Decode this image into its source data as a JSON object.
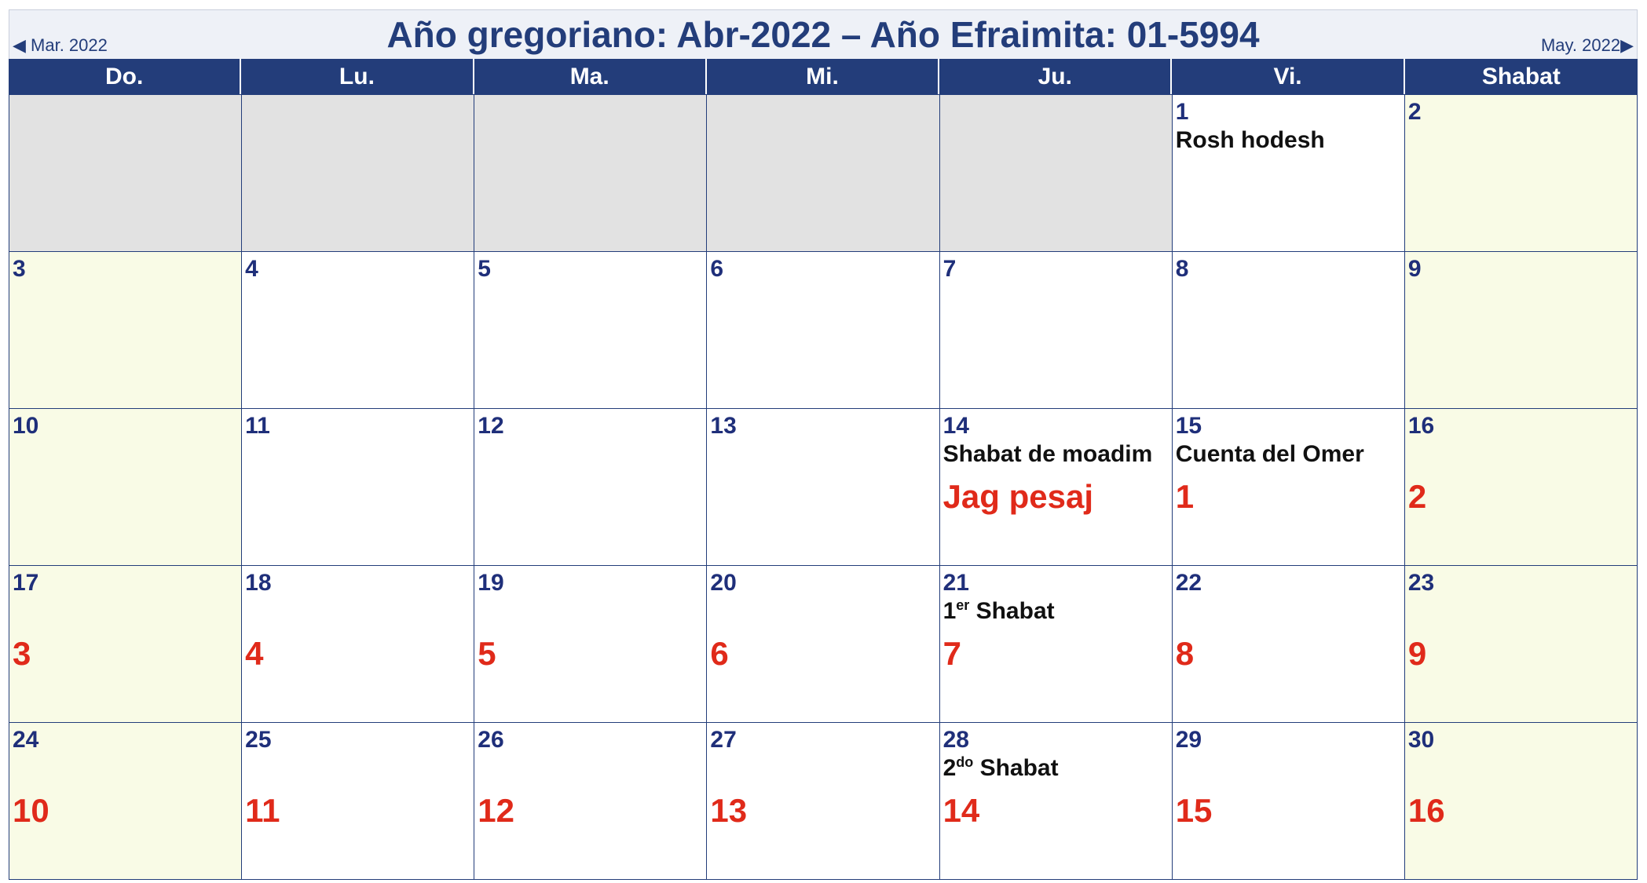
{
  "calendar": {
    "title": "Año gregoriano: Abr-2022 – Año Efraimita: 01-5994",
    "prev_month": "◀ Mar. 2022",
    "next_month": "May. 2022▶",
    "weekdays": [
      "Do.",
      "Lu.",
      "Ma.",
      "Mi.",
      "Ju.",
      "Vi.",
      "Shabat"
    ],
    "colors": {
      "header_blue": "#233d7a",
      "day_number": "#1f2f7a",
      "efraimite_red": "#e02a1a",
      "weekend_bg": "#f9fbe6",
      "empty_bg": "#e2e2e2"
    },
    "weeks": [
      [
        {
          "empty": true
        },
        {
          "empty": true
        },
        {
          "empty": true
        },
        {
          "empty": true
        },
        {
          "empty": true
        },
        {
          "day": "1",
          "event": "Rosh hodesh"
        },
        {
          "day": "2",
          "weekend": true
        }
      ],
      [
        {
          "day": "3",
          "weekend": true
        },
        {
          "day": "4"
        },
        {
          "day": "5"
        },
        {
          "day": "6"
        },
        {
          "day": "7"
        },
        {
          "day": "8"
        },
        {
          "day": "9",
          "weekend": true
        }
      ],
      [
        {
          "day": "10",
          "weekend": true
        },
        {
          "day": "11"
        },
        {
          "day": "12"
        },
        {
          "day": "13"
        },
        {
          "day": "14",
          "event": "Shabat de moadim",
          "efraimite": "Jag pesaj"
        },
        {
          "day": "15",
          "event": "Cuenta del Omer",
          "efraimite": "1"
        },
        {
          "day": "16",
          "weekend": true,
          "efraimite": "2"
        }
      ],
      [
        {
          "day": "17",
          "weekend": true,
          "efraimite": "3"
        },
        {
          "day": "18",
          "efraimite": "4"
        },
        {
          "day": "19",
          "efraimite": "5"
        },
        {
          "day": "20",
          "efraimite": "6"
        },
        {
          "day": "21",
          "event_ordinal": "1",
          "event_sup": "er",
          "event": " Shabat",
          "efraimite": "7"
        },
        {
          "day": "22",
          "efraimite": "8"
        },
        {
          "day": "23",
          "weekend": true,
          "efraimite": "9"
        }
      ],
      [
        {
          "day": "24",
          "weekend": true,
          "efraimite": "10"
        },
        {
          "day": "25",
          "efraimite": "11"
        },
        {
          "day": "26",
          "efraimite": "12"
        },
        {
          "day": "27",
          "efraimite": "13"
        },
        {
          "day": "28",
          "event_ordinal": "2",
          "event_sup": "do",
          "event": " Shabat",
          "efraimite": "14"
        },
        {
          "day": "29",
          "efraimite": "15"
        },
        {
          "day": "30",
          "weekend": true,
          "efraimite": "16"
        }
      ]
    ]
  }
}
